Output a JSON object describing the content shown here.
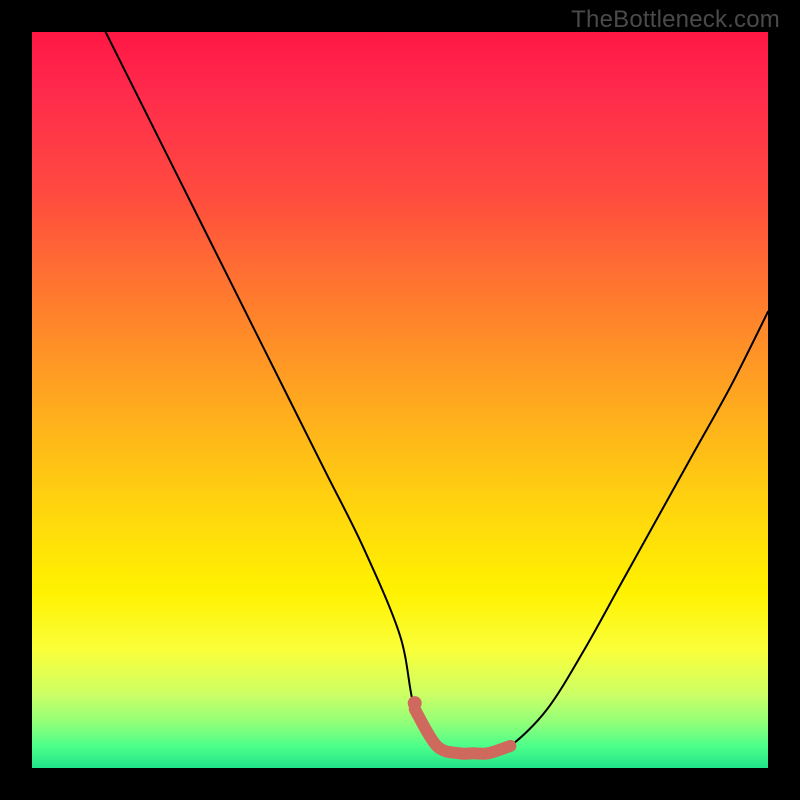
{
  "watermark": "TheBottleneck.com",
  "chart_data": {
    "type": "line",
    "title": "",
    "xlabel": "",
    "ylabel": "",
    "xlim": [
      0,
      100
    ],
    "ylim": [
      0,
      100
    ],
    "grid": false,
    "legend": false,
    "series": [
      {
        "name": "bottleneck-curve",
        "x": [
          10,
          15,
          20,
          25,
          30,
          35,
          40,
          45,
          50,
          52,
          55,
          58,
          60,
          62,
          65,
          70,
          75,
          80,
          85,
          90,
          95,
          100
        ],
        "values": [
          100,
          90,
          80,
          70,
          60,
          50,
          40,
          30,
          18,
          8,
          3,
          2,
          2,
          2,
          3,
          8,
          16,
          25,
          34,
          43,
          52,
          62
        ]
      }
    ],
    "highlight": {
      "name": "valley-marker",
      "color": "#d0695d",
      "x": [
        52,
        55,
        58,
        60,
        62,
        65
      ],
      "values": [
        8,
        3,
        2,
        2,
        2,
        3
      ]
    }
  }
}
